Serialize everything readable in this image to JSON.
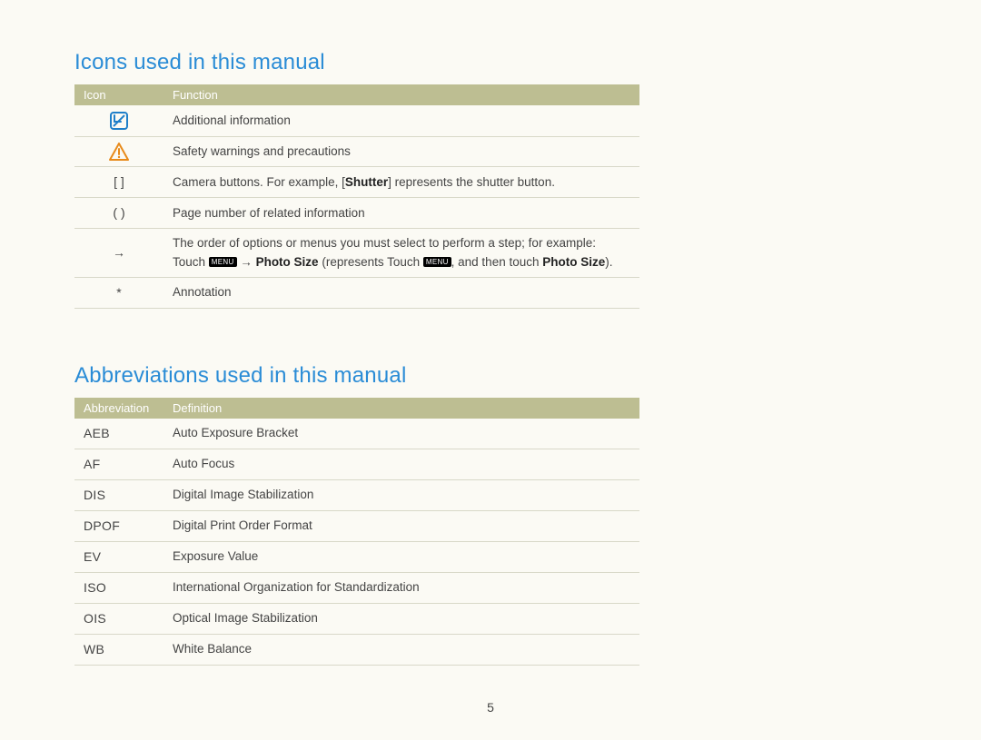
{
  "sections": {
    "icons": {
      "title": "Icons used in this manual",
      "headers": {
        "col1": "Icon",
        "col2": "Function"
      },
      "rows": {
        "info": {
          "desc": "Additional information"
        },
        "warn": {
          "desc": "Safety warnings and precautions"
        },
        "brackets": {
          "icon": "[  ]",
          "desc_prefix": "Camera buttons. For example, [",
          "desc_bold": "Shutter",
          "desc_suffix": "] represents the shutter button."
        },
        "parens": {
          "icon": "(  )",
          "desc": "Page number of related information"
        },
        "arrow": {
          "icon": "→",
          "line1": "The order of options or menus you must select to perform a step; for example:",
          "touch": "Touch ",
          "menu_label": "MENU",
          "arrow_sym": " → ",
          "photo_size": "Photo Size",
          "represents": " (represents Touch ",
          "and_then": ", and then touch ",
          "close": ")."
        },
        "star": {
          "icon": "*",
          "desc": "Annotation"
        }
      }
    },
    "abbrev": {
      "title": "Abbreviations used in this manual",
      "headers": {
        "col1": "Abbreviation",
        "col2": "Definition"
      },
      "rows": [
        {
          "abbr": "AEB",
          "def": "Auto Exposure Bracket"
        },
        {
          "abbr": "AF",
          "def": "Auto Focus"
        },
        {
          "abbr": "DIS",
          "def": "Digital Image Stabilization"
        },
        {
          "abbr": "DPOF",
          "def": "Digital Print Order Format"
        },
        {
          "abbr": "EV",
          "def": "Exposure Value"
        },
        {
          "abbr": "ISO",
          "def": "International Organization for Standardization"
        },
        {
          "abbr": "OIS",
          "def": "Optical Image Stabilization"
        },
        {
          "abbr": "WB",
          "def": "White Balance"
        }
      ]
    }
  },
  "page_number": "5"
}
